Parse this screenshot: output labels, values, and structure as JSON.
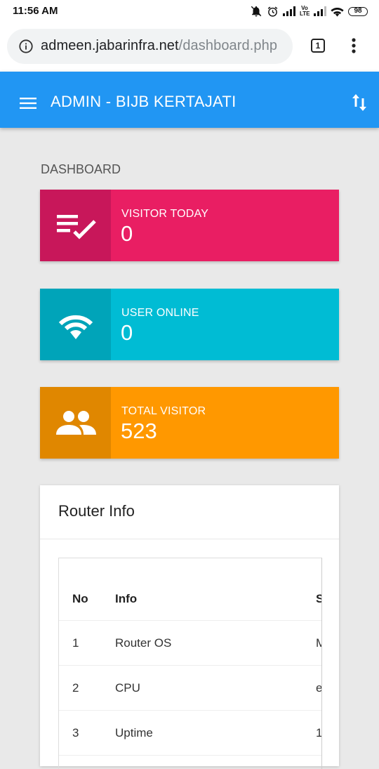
{
  "status_bar": {
    "time": "11:56 AM",
    "network": "Vo LTE",
    "battery": "98"
  },
  "browser": {
    "url_domain": "admeen.jabarinfra.net",
    "url_path": "/dashboard.php",
    "tab_count": "1"
  },
  "app_bar": {
    "title": "ADMIN - BIJB KERTAJATI"
  },
  "page": {
    "title": "DASHBOARD"
  },
  "cards": [
    {
      "label": "VISITOR TODAY",
      "value": "0",
      "icon": "playlist-check-icon",
      "color": "#e91e63"
    },
    {
      "label": "USER ONLINE",
      "value": "0",
      "icon": "wifi-icon",
      "color": "#00bcd4"
    },
    {
      "label": "TOTAL VISITOR",
      "value": "523",
      "icon": "people-icon",
      "color": "#ff9800"
    }
  ],
  "router": {
    "title": "Router Info",
    "headers": [
      "No",
      "Info",
      "S"
    ],
    "rows": [
      {
        "no": "1",
        "info": "Router OS",
        "status": "M"
      },
      {
        "no": "2",
        "info": "CPU",
        "status": "e"
      },
      {
        "no": "3",
        "info": "Uptime",
        "status": "1"
      }
    ]
  }
}
